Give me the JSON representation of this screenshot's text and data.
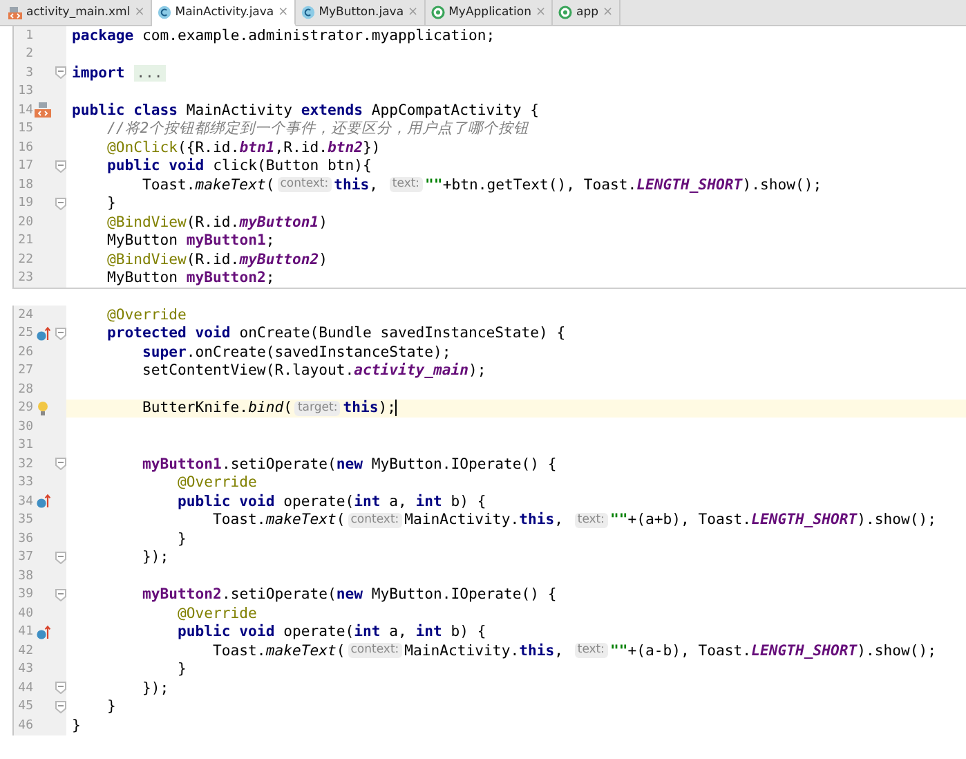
{
  "tabs": [
    {
      "label": "activity_main.xml",
      "kind": "xml",
      "close": "×",
      "selected": false
    },
    {
      "label": "MainActivity.java",
      "kind": "class",
      "close": "×",
      "selected": true
    },
    {
      "label": "MyButton.java",
      "kind": "class",
      "close": "×",
      "selected": false
    },
    {
      "label": "MyApplication",
      "kind": "module",
      "close": "×",
      "selected": false
    },
    {
      "label": "app",
      "kind": "module",
      "close": "×",
      "selected": false
    }
  ],
  "sections": [
    {
      "lines": [
        {
          "number": "1",
          "kind": "plain",
          "fold": false,
          "current": false,
          "tokens": [
            {
              "kind": "kw",
              "t": "package"
            },
            {
              "kind": "plain",
              "t": " com.example.administrator.myapplication;"
            }
          ]
        },
        {
          "number": "2",
          "kind": "plain",
          "fold": false,
          "current": false
        },
        {
          "number": "3",
          "kind": "plain",
          "fold": true,
          "current": false,
          "tokens": [
            {
              "kind": "kw",
              "t": "import "
            },
            {
              "kind": "folded",
              "t": "..."
            }
          ]
        },
        {
          "number": "13",
          "kind": "plain",
          "fold": false,
          "current": false
        },
        {
          "number": "14",
          "kind": "class",
          "fold": false,
          "current": false,
          "tokens": [
            {
              "kind": "kw",
              "t": "public class "
            },
            {
              "kind": "plain",
              "t": "MainActivity "
            },
            {
              "kind": "kw",
              "t": "extends "
            },
            {
              "kind": "plain",
              "t": "AppCompatActivity {"
            }
          ]
        },
        {
          "number": "15",
          "kind": "plain",
          "fold": false,
          "current": false,
          "tokens": [
            {
              "kind": "comment",
              "t": "    //将2个按钮都绑定到一个事件，还要区分，用户点了哪个按钮"
            }
          ]
        },
        {
          "number": "16",
          "kind": "plain",
          "fold": false,
          "current": false,
          "tokens": [
            {
              "kind": "ann",
              "t": "    @OnClick"
            },
            {
              "kind": "plain",
              "t": "({R.id."
            },
            {
              "kind": "sf",
              "t": "btn1"
            },
            {
              "kind": "plain",
              "t": ",R.id."
            },
            {
              "kind": "sf",
              "t": "btn2"
            },
            {
              "kind": "plain",
              "t": "})"
            }
          ]
        },
        {
          "number": "17",
          "kind": "plain",
          "fold": true,
          "current": false,
          "tokens": [
            {
              "kind": "kw",
              "t": "    public void "
            },
            {
              "kind": "plain",
              "t": "click(Button btn){"
            }
          ]
        },
        {
          "number": "18",
          "kind": "plain",
          "fold": false,
          "current": false,
          "tokens": [
            {
              "kind": "plain",
              "t": "        Toast."
            },
            {
              "kind": "mi",
              "t": "makeText"
            },
            {
              "kind": "plain",
              "t": "("
            },
            {
              "kind": "hint",
              "t": "context:"
            },
            {
              "kind": "kw",
              "t": "this"
            },
            {
              "kind": "plain",
              "t": ", "
            },
            {
              "kind": "hint",
              "t": "text:"
            },
            {
              "kind": "str",
              "t": "\"\""
            },
            {
              "kind": "plain",
              "t": "+btn.getText(), Toast."
            },
            {
              "kind": "sf",
              "t": "LENGTH_SHORT"
            },
            {
              "kind": "plain",
              "t": ").show();"
            }
          ]
        },
        {
          "number": "19",
          "kind": "plain",
          "fold": true,
          "current": false,
          "tokens": [
            {
              "kind": "plain",
              "t": "    }"
            }
          ]
        },
        {
          "number": "20",
          "kind": "plain",
          "fold": false,
          "current": false,
          "tokens": [
            {
              "kind": "ann",
              "t": "    @BindView"
            },
            {
              "kind": "plain",
              "t": "(R.id."
            },
            {
              "kind": "sf",
              "t": "myButton1"
            },
            {
              "kind": "plain",
              "t": ")"
            }
          ]
        },
        {
          "number": "21",
          "kind": "plain",
          "fold": false,
          "current": false,
          "tokens": [
            {
              "kind": "plain",
              "t": "    MyButton "
            },
            {
              "kind": "field",
              "t": "myButton1"
            },
            {
              "kind": "plain",
              "t": ";"
            }
          ]
        },
        {
          "number": "22",
          "kind": "plain",
          "fold": false,
          "current": false,
          "tokens": [
            {
              "kind": "ann",
              "t": "    @BindView"
            },
            {
              "kind": "plain",
              "t": "(R.id."
            },
            {
              "kind": "sf",
              "t": "myButton2"
            },
            {
              "kind": "plain",
              "t": ")"
            }
          ]
        },
        {
          "number": "23",
          "kind": "plain",
          "fold": false,
          "current": false,
          "tokens": [
            {
              "kind": "plain",
              "t": "    MyButton "
            },
            {
              "kind": "field",
              "t": "myButton2"
            },
            {
              "kind": "plain",
              "t": ";"
            }
          ]
        }
      ]
    },
    {
      "lines": [
        {
          "number": "24",
          "kind": "plain",
          "fold": false,
          "current": false,
          "tokens": [
            {
              "kind": "ann",
              "t": "    @Override"
            }
          ]
        },
        {
          "number": "25",
          "kind": "override",
          "fold": true,
          "current": false,
          "tokens": [
            {
              "kind": "kw",
              "t": "    protected void "
            },
            {
              "kind": "plain",
              "t": "onCreate(Bundle savedInstanceState) {"
            }
          ]
        },
        {
          "number": "26",
          "kind": "plain",
          "fold": false,
          "current": false,
          "tokens": [
            {
              "kind": "kw",
              "t": "        super"
            },
            {
              "kind": "plain",
              "t": ".onCreate(savedInstanceState);"
            }
          ]
        },
        {
          "number": "27",
          "kind": "plain",
          "fold": false,
          "current": false,
          "tokens": [
            {
              "kind": "plain",
              "t": "        setContentView(R.layout."
            },
            {
              "kind": "sf",
              "t": "activity_main"
            },
            {
              "kind": "plain",
              "t": ");"
            }
          ]
        },
        {
          "number": "28",
          "kind": "plain",
          "fold": false,
          "current": false
        },
        {
          "number": "29",
          "kind": "bulb",
          "fold": false,
          "current": true,
          "tokens": [
            {
              "kind": "plain",
              "t": "        ButterKnife."
            },
            {
              "kind": "mi",
              "t": "bind"
            },
            {
              "kind": "plain",
              "t": "("
            },
            {
              "kind": "hint",
              "t": "target:"
            },
            {
              "kind": "kw",
              "t": "this"
            },
            {
              "kind": "plain",
              "t": ");"
            }
          ]
        },
        {
          "number": "30",
          "kind": "plain",
          "fold": false,
          "current": false
        },
        {
          "number": "31",
          "kind": "plain",
          "fold": false,
          "current": false
        },
        {
          "number": "32",
          "kind": "plain",
          "fold": true,
          "current": false,
          "tokens": [
            {
              "kind": "field",
              "t": "        myButton1"
            },
            {
              "kind": "plain",
              "t": ".setiOperate("
            },
            {
              "kind": "kw",
              "t": "new "
            },
            {
              "kind": "plain",
              "t": "MyButton.IOperate() {"
            }
          ]
        },
        {
          "number": "33",
          "kind": "plain",
          "fold": false,
          "current": false,
          "tokens": [
            {
              "kind": "ann",
              "t": "            @Override"
            }
          ]
        },
        {
          "number": "34",
          "kind": "override",
          "fold": false,
          "current": false,
          "tokens": [
            {
              "kind": "kw",
              "t": "            public void "
            },
            {
              "kind": "plain",
              "t": "operate("
            },
            {
              "kind": "kw",
              "t": "int "
            },
            {
              "kind": "plain",
              "t": "a, "
            },
            {
              "kind": "kw",
              "t": "int "
            },
            {
              "kind": "plain",
              "t": "b) {"
            }
          ]
        },
        {
          "number": "35",
          "kind": "plain",
          "fold": false,
          "current": false,
          "tokens": [
            {
              "kind": "plain",
              "t": "                Toast."
            },
            {
              "kind": "mi",
              "t": "makeText"
            },
            {
              "kind": "plain",
              "t": "("
            },
            {
              "kind": "hint",
              "t": "context:"
            },
            {
              "kind": "plain",
              "t": "MainActivity."
            },
            {
              "kind": "kw",
              "t": "this"
            },
            {
              "kind": "plain",
              "t": ", "
            },
            {
              "kind": "hint",
              "t": "text:"
            },
            {
              "kind": "str",
              "t": "\"\""
            },
            {
              "kind": "plain",
              "t": "+(a+b), Toast."
            },
            {
              "kind": "sf",
              "t": "LENGTH_SHORT"
            },
            {
              "kind": "plain",
              "t": ").show();"
            }
          ]
        },
        {
          "number": "36",
          "kind": "plain",
          "fold": false,
          "current": false,
          "tokens": [
            {
              "kind": "plain",
              "t": "            }"
            }
          ]
        },
        {
          "number": "37",
          "kind": "plain",
          "fold": true,
          "current": false,
          "tokens": [
            {
              "kind": "plain",
              "t": "        });"
            }
          ]
        },
        {
          "number": "38",
          "kind": "plain",
          "fold": false,
          "current": false
        },
        {
          "number": "39",
          "kind": "plain",
          "fold": true,
          "current": false,
          "tokens": [
            {
              "kind": "field",
              "t": "        myButton2"
            },
            {
              "kind": "plain",
              "t": ".setiOperate("
            },
            {
              "kind": "kw",
              "t": "new "
            },
            {
              "kind": "plain",
              "t": "MyButton.IOperate() {"
            }
          ]
        },
        {
          "number": "40",
          "kind": "plain",
          "fold": false,
          "current": false,
          "tokens": [
            {
              "kind": "ann",
              "t": "            @Override"
            }
          ]
        },
        {
          "number": "41",
          "kind": "override",
          "fold": false,
          "current": false,
          "tokens": [
            {
              "kind": "kw",
              "t": "            public void "
            },
            {
              "kind": "plain",
              "t": "operate("
            },
            {
              "kind": "kw",
              "t": "int "
            },
            {
              "kind": "plain",
              "t": "a, "
            },
            {
              "kind": "kw",
              "t": "int "
            },
            {
              "kind": "plain",
              "t": "b) {"
            }
          ]
        },
        {
          "number": "42",
          "kind": "plain",
          "fold": false,
          "current": false,
          "tokens": [
            {
              "kind": "plain",
              "t": "                Toast."
            },
            {
              "kind": "mi",
              "t": "makeText"
            },
            {
              "kind": "plain",
              "t": "("
            },
            {
              "kind": "hint",
              "t": "context:"
            },
            {
              "kind": "plain",
              "t": "MainActivity."
            },
            {
              "kind": "kw",
              "t": "this"
            },
            {
              "kind": "plain",
              "t": ", "
            },
            {
              "kind": "hint",
              "t": "text:"
            },
            {
              "kind": "str",
              "t": "\"\""
            },
            {
              "kind": "plain",
              "t": "+(a-b), Toast."
            },
            {
              "kind": "sf",
              "t": "LENGTH_SHORT"
            },
            {
              "kind": "plain",
              "t": ").show();"
            }
          ]
        },
        {
          "number": "43",
          "kind": "plain",
          "fold": false,
          "current": false,
          "tokens": [
            {
              "kind": "plain",
              "t": "            }"
            }
          ]
        },
        {
          "number": "44",
          "kind": "plain",
          "fold": true,
          "current": false,
          "tokens": [
            {
              "kind": "plain",
              "t": "        });"
            }
          ]
        },
        {
          "number": "45",
          "kind": "plain",
          "fold": true,
          "current": false,
          "tokens": [
            {
              "kind": "plain",
              "t": "    }"
            }
          ]
        },
        {
          "number": "46",
          "kind": "plain",
          "fold": false,
          "current": false,
          "tokens": [
            {
              "kind": "plain",
              "t": "}"
            }
          ]
        }
      ]
    }
  ]
}
